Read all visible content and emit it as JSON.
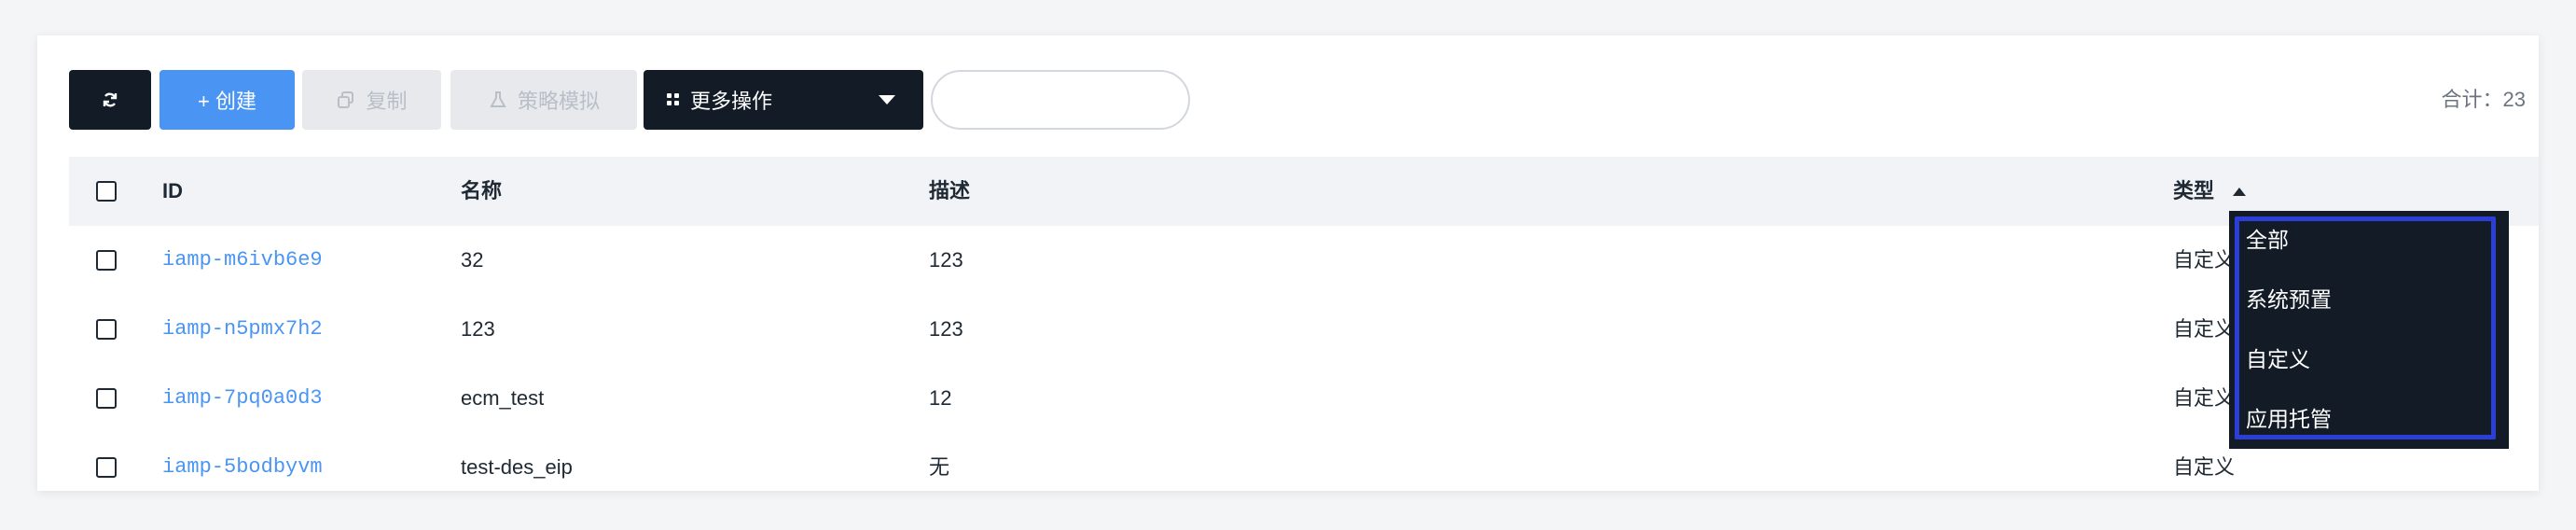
{
  "toolbar": {
    "refresh_icon": "refresh-icon",
    "create_label": "+ 创建",
    "copy_label": "复制",
    "policy_sim_label": "策略模拟",
    "more_label": "更多操作",
    "search_value": "",
    "total_label": "合计：23"
  },
  "table": {
    "columns": [
      "ID",
      "名称",
      "描述",
      "类型"
    ],
    "sort": "ascending",
    "rows": [
      {
        "id": "iamp-m6ivb6e9",
        "name": "32",
        "desc": "123",
        "type": "自定义"
      },
      {
        "id": "iamp-n5pmx7h2",
        "name": "123",
        "desc": "123",
        "type": "自定义"
      },
      {
        "id": "iamp-7pq0a0d3",
        "name": "ecm_test",
        "desc": "12",
        "type": "自定义"
      },
      {
        "id": "iamp-5bodbyvm",
        "name": "test-des_eip",
        "desc": "无",
        "type": "自定义"
      }
    ]
  },
  "type_filter": {
    "options": [
      "全部",
      "系统预置",
      "自定义",
      "应用托管"
    ]
  },
  "colors": {
    "primary": "#4a95f3",
    "dark": "#121b26",
    "highlight_border": "#2b3ed6"
  }
}
